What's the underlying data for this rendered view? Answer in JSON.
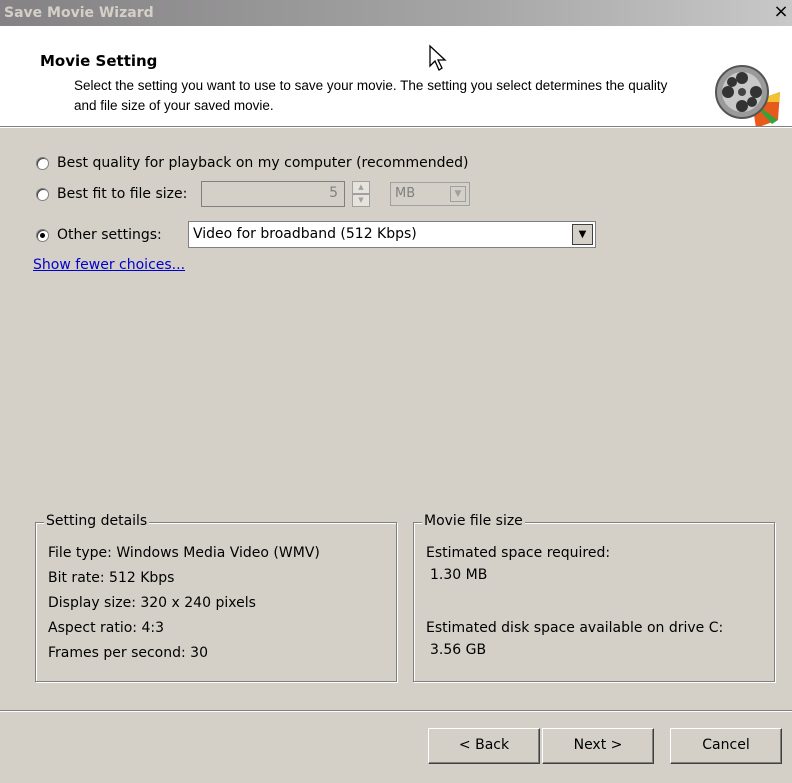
{
  "window": {
    "title": "Save Movie Wizard",
    "close_label": "×"
  },
  "header": {
    "title": "Movie Setting",
    "description": "Select the setting you want to use to save your movie. The setting you select determines the quality and file size of your saved movie."
  },
  "options": {
    "best_quality_label": "Best quality for playback on my computer (recommended)",
    "best_fit_label": "Best fit to file size:",
    "best_fit_value": "5",
    "best_fit_unit": "MB",
    "other_settings_label": "Other settings:",
    "other_settings_value": "Video for broadband (512 Kbps)",
    "selected": "other_settings",
    "show_fewer_link": "Show fewer choices..."
  },
  "setting_details": {
    "legend": "Setting details",
    "lines": [
      "File type: Windows Media Video (WMV)",
      "Bit rate: 512 Kbps",
      "Display size: 320 x 240 pixels",
      "Aspect ratio: 4:3",
      "Frames per second: 30"
    ]
  },
  "movie_file_size": {
    "legend": "Movie file size",
    "required_label": "Estimated space required:",
    "required_value": "1.30 MB",
    "available_label": "Estimated disk space available on drive C:",
    "available_value": "3.56 GB"
  },
  "buttons": {
    "back": "< Back",
    "next": "Next >",
    "cancel": "Cancel"
  },
  "icons": {
    "logo": "film-reel-icon",
    "cursor": "mouse-pointer-icon"
  }
}
